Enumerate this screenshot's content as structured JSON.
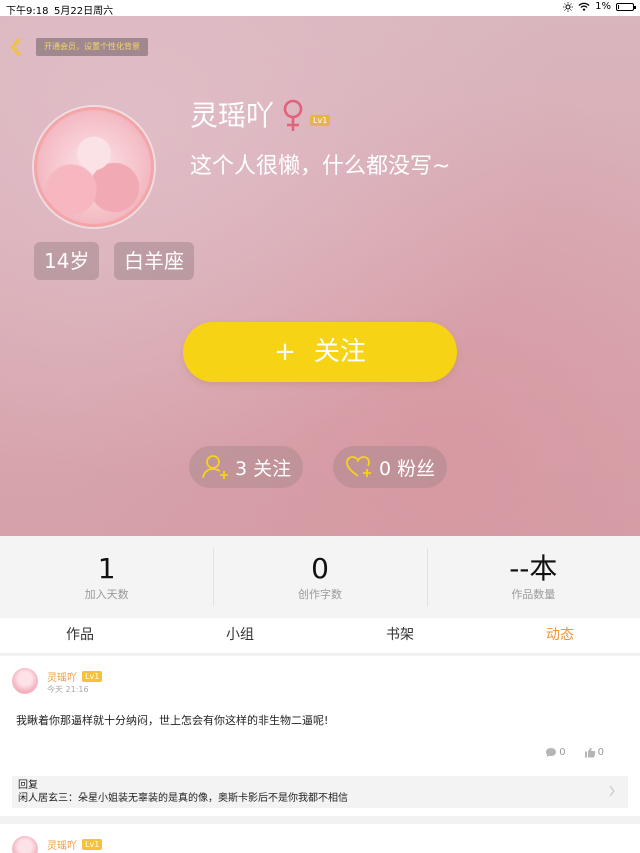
{
  "status_bar": {
    "time": "下午9:18",
    "date": "5月22日周六",
    "battery": "1%",
    "battery_level": 0.01
  },
  "header": {
    "vip_tip": "开通会员，设置个性化背景",
    "username": "灵瑶吖",
    "level": "Lv1",
    "signature": "这个人很懒，什么都没写~",
    "tags": [
      "14岁",
      "白羊座"
    ],
    "follow_button": "关注",
    "follow_plus": "+",
    "following": "3 关注",
    "fans": "0 粉丝"
  },
  "counts": [
    {
      "value": "1",
      "label": "加入天数"
    },
    {
      "value": "0",
      "label": "创作字数"
    },
    {
      "value": "--本",
      "label": "作品数量"
    }
  ],
  "tabs": [
    {
      "label": "作品",
      "active": false
    },
    {
      "label": "小组",
      "active": false
    },
    {
      "label": "书架",
      "active": false
    },
    {
      "label": "动态",
      "active": true
    }
  ],
  "posts": [
    {
      "author": "灵瑶吖",
      "level": "Lv1",
      "time": "今天 21:16",
      "text": "我瞅着你那逼样就十分纳闷，世上怎会有你这样的非生物二逼呢!",
      "comments": "0",
      "likes": "0",
      "reply_title": "回复",
      "reply_text": "闲人居玄三：朵星小姐装无辜装的是真的像，奥斯卡影后不是你我都不相信"
    },
    {
      "author": "灵瑶吖",
      "level": "Lv1"
    }
  ],
  "colors": {
    "accent": "#f0953b",
    "follow_button": "#f7d316",
    "level_badge": "#e6b54a",
    "gender": "#e0637a"
  }
}
